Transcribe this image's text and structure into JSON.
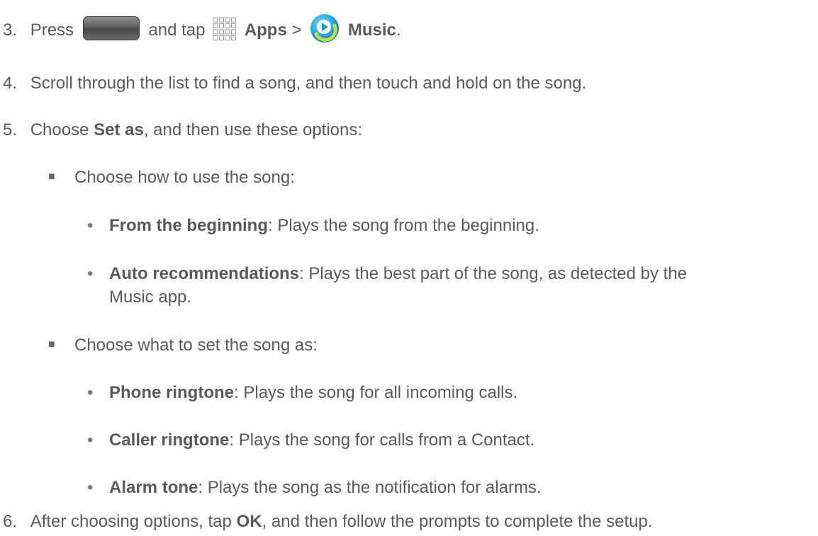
{
  "steps": {
    "s3": {
      "number": "3.",
      "t1": "Press",
      "t2": "and tap",
      "apps": "Apps",
      "gt": ">",
      "music": "Music",
      "end": "."
    },
    "s4": {
      "number": "4.",
      "text": "Scroll through the list to find a song, and then touch and hold on the song."
    },
    "s5": {
      "number": "5.",
      "t1": "Choose",
      "bold": "Set as",
      "t2": ", and then use these options:"
    },
    "s6": {
      "number": "6.",
      "t1": "After choosing options, tap",
      "bold": "OK",
      "t2": ", and then follow the prompts to complete the setup."
    }
  },
  "group_how": {
    "label": "Choose how to use the song:",
    "items": [
      {
        "bold": "From the beginning",
        "text": ": Plays the song from the beginning."
      },
      {
        "bold": "Auto recommendations",
        "text": ": Plays the best part of the song, as detected by the",
        "text2": "Music app."
      }
    ]
  },
  "group_what": {
    "label": "Choose what to set the song as:",
    "items": [
      {
        "bold": "Phone ringtone",
        "text": ": Plays the song for all incoming calls."
      },
      {
        "bold": "Caller ringtone",
        "text": ": Plays the song for calls from a Contact."
      },
      {
        "bold": "Alarm tone",
        "text": ": Plays the song as the notification for alarms."
      }
    ]
  },
  "icons": {
    "home": "home-key-icon",
    "apps": "apps-grid-icon",
    "music": "music-app-icon"
  }
}
